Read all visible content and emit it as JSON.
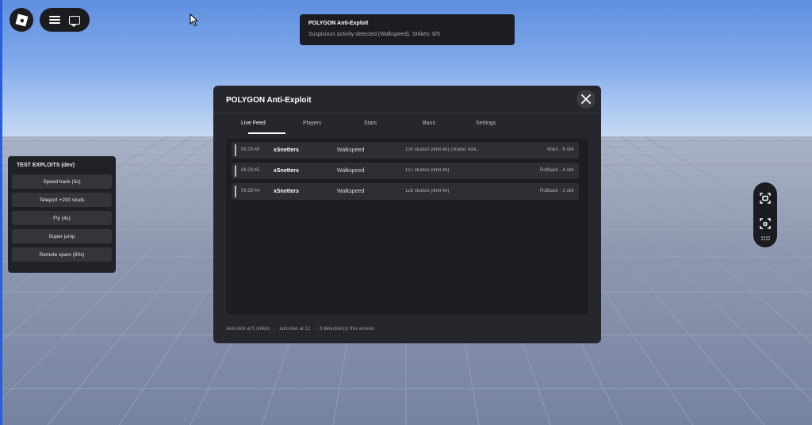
{
  "toast": {
    "title": "POLYGON Anti-Exploit",
    "message": "Suspicious activity detected (Walkspeed). Strikes: 6/5"
  },
  "test_panel": {
    "title": "TEST EXPLOITS (dev)",
    "buttons": [
      "Speed hack (3s)",
      "Teleport +200 studs",
      "Fly (4s)",
      "Super jump",
      "Remote spam (60x)"
    ]
  },
  "dialog": {
    "title": "POLYGON Anti-Exploit",
    "tabs": [
      "Live Feed",
      "Players",
      "Stats",
      "Bans",
      "Settings"
    ],
    "active_tab": "Live Feed",
    "feed": [
      {
        "time": "06:29:46",
        "user": "xSnetters",
        "type": "Walkspeed",
        "detail": "100 studs/s (limit 40) (Studio: kick…",
        "action": "Warn · 6 strk"
      },
      {
        "time": "06:29:45",
        "user": "xSnetters",
        "type": "Walkspeed",
        "detail": "127 studs/s (limit 40)",
        "action": "Rollback · 4 strk"
      },
      {
        "time": "06:28:44",
        "user": "xSnetters",
        "type": "Walkspeed",
        "detail": "128 studs/s (limit 40)",
        "action": "Rollback · 2 strk"
      }
    ],
    "footer": [
      "Auto-kick at 5 strikes",
      "auto-ban at 12",
      "3 detection(s) this session"
    ]
  },
  "icons": {
    "roblox": "roblox-logo-icon",
    "menu": "hamburger-menu-icon",
    "chat": "chat-icon",
    "close": "close-icon",
    "capture": "screen-capture-icon",
    "selfview": "self-view-icon",
    "grip": "grip-dots-icon"
  },
  "colors": {
    "panel": "#26272c",
    "row": "#2d2f34",
    "feed_bg": "#1d1e22",
    "sky": "#7fa9ea"
  }
}
